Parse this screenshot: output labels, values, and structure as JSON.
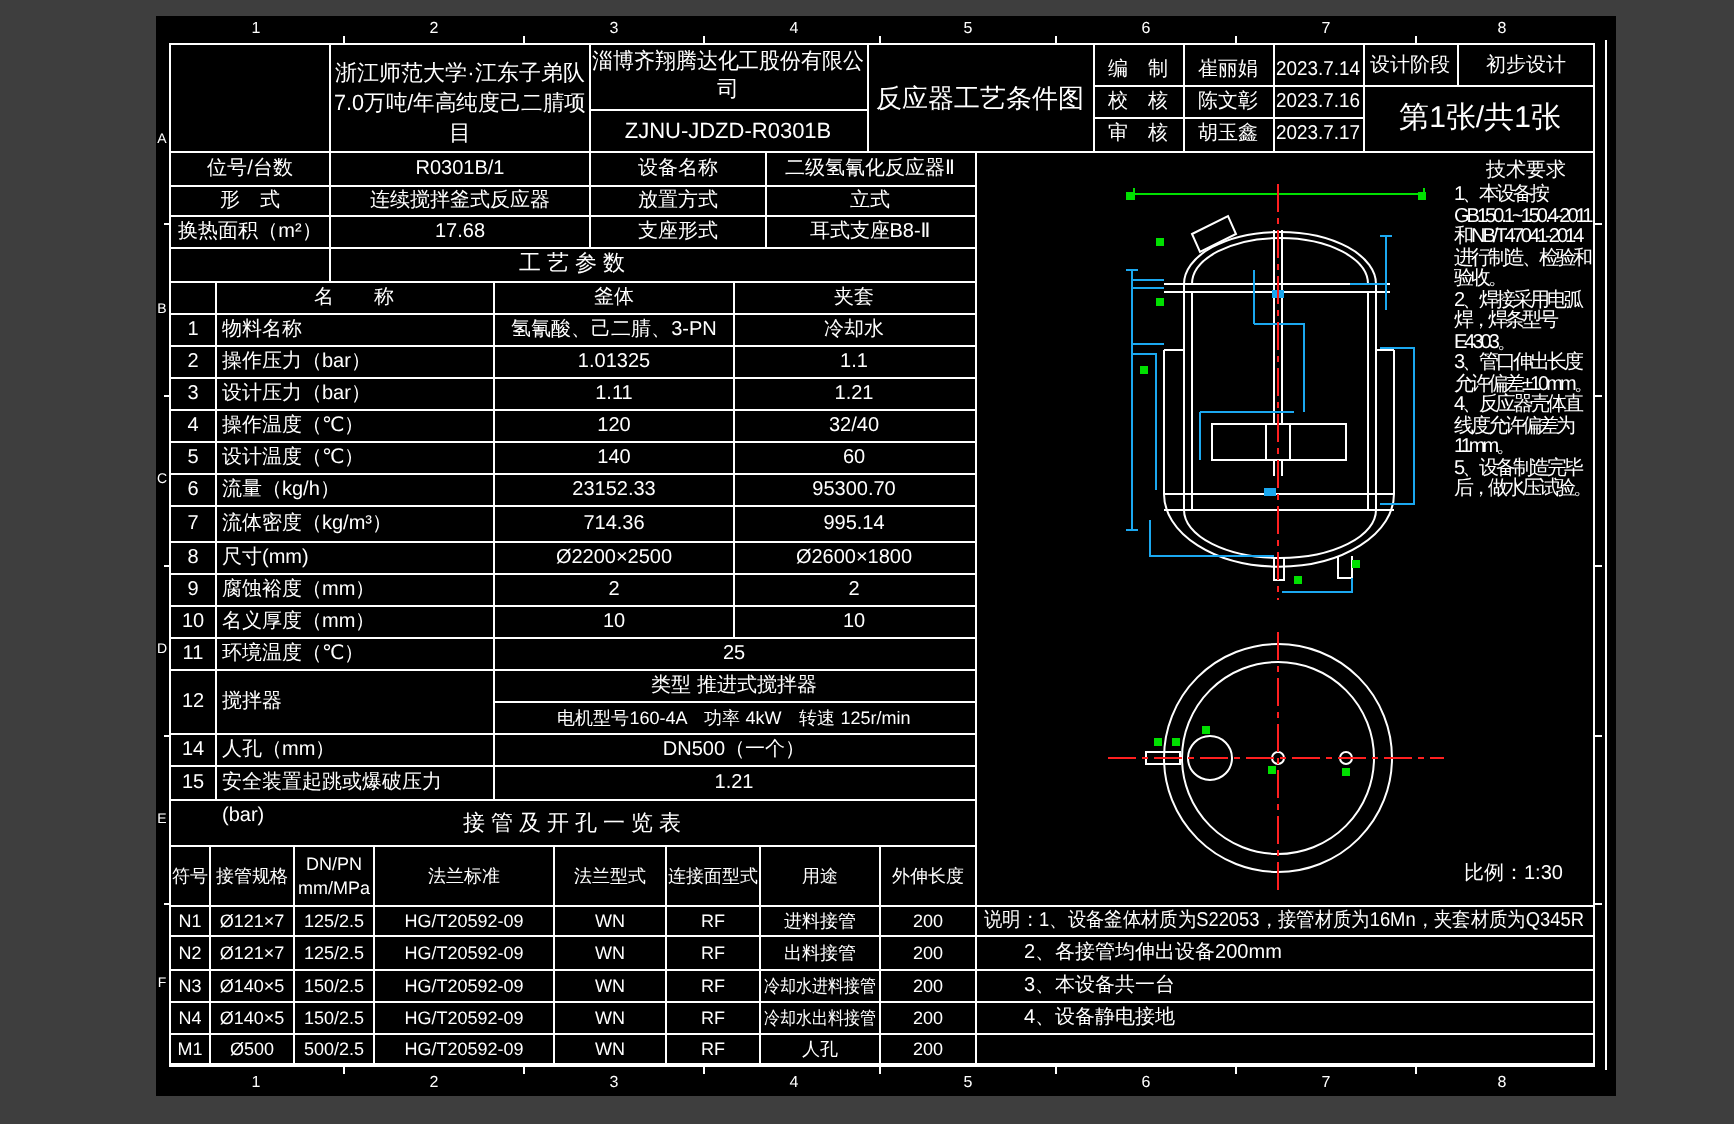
{
  "ruler": {
    "top_columns": [
      "1",
      "2",
      "3",
      "4",
      "5",
      "6",
      "7",
      "8"
    ],
    "bottom_columns": [
      "1",
      "2",
      "3",
      "4",
      "5",
      "6",
      "7",
      "8"
    ],
    "rows": [
      "A",
      "B",
      "C",
      "D",
      "E",
      "F"
    ]
  },
  "title_block": {
    "project_lines": [
      "浙江师范大学·江东子弟队",
      "7.0万吨/年高纯度己二腈项",
      "目"
    ],
    "company_lines": [
      "淄博齐翔腾达化工股份有限公",
      "司"
    ],
    "drawing_no": "ZJNU-JDZD-R0301B",
    "title": "反应器工艺条件图",
    "signatures": [
      {
        "role": "编　制",
        "name": "崔丽娟",
        "date": "2023.7.14"
      },
      {
        "role": "校　核",
        "name": "陈文彰",
        "date": "2023.7.16"
      },
      {
        "role": "审　核",
        "name": "胡玉鑫",
        "date": "2023.7.17"
      }
    ],
    "stage_label": "设计阶段",
    "stage": "初步设计",
    "sheet": "第1张/共1张"
  },
  "info_rows": [
    {
      "label": "位号/台数",
      "value": "R0301B/1",
      "label2": "设备名称",
      "value2": "二级氢氰化反应器Ⅱ"
    },
    {
      "label": "形　式",
      "value": "连续搅拌釜式反应器",
      "label2": "放置方式",
      "value2": "立式"
    },
    {
      "label": "换热面积（m²）",
      "value": "17.68",
      "label2": "支座形式",
      "value2": "耳式支座B8-Ⅱ"
    }
  ],
  "parameters": {
    "title": "工 艺 参 数",
    "columns": [
      "名　　称",
      "釜体",
      "夹套"
    ],
    "rows": [
      {
        "kind": "pair",
        "no": "1",
        "name": "物料名称",
        "body": "氢氰酸、己二腈、3-PN",
        "jacket": "冷却水"
      },
      {
        "kind": "pair",
        "no": "2",
        "name": "操作压力（bar）",
        "body": "1.01325",
        "jacket": "1.1"
      },
      {
        "kind": "pair",
        "no": "3",
        "name": "设计压力（bar）",
        "body": "1.11",
        "jacket": "1.21"
      },
      {
        "kind": "pair",
        "no": "4",
        "name": "操作温度（℃）",
        "body": "120",
        "jacket": "32/40"
      },
      {
        "kind": "pair",
        "no": "5",
        "name": "设计温度（℃）",
        "body": "140",
        "jacket": "60"
      },
      {
        "kind": "pair",
        "no": "6",
        "name": "流量（kg/h）",
        "body": "23152.33",
        "jacket": "95300.70"
      },
      {
        "kind": "pair",
        "no": "7",
        "name": "流体密度（kg/m³）",
        "body": "714.36",
        "jacket": "995.14"
      },
      {
        "kind": "pair",
        "no": "8",
        "name": "尺寸(mm)",
        "body": "Ø2200×2500",
        "jacket": "Ø2600×1800"
      },
      {
        "kind": "pair",
        "no": "9",
        "name": "腐蚀裕度（mm）",
        "body": "2",
        "jacket": "2"
      },
      {
        "kind": "pair",
        "no": "10",
        "name": "名义厚度（mm）",
        "body": "10",
        "jacket": "10"
      },
      {
        "kind": "merged",
        "no": "11",
        "name": "环境温度（℃）",
        "value": "25"
      },
      {
        "kind": "agitator",
        "no": "12",
        "name": "搅拌器",
        "lines": [
          "类型 推进式搅拌器",
          "电机型号160-4A　功率 4kW　转速 125r/min"
        ]
      },
      {
        "kind": "merged",
        "no": "14",
        "name": "人孔（mm）",
        "value": "DN500（一个）"
      },
      {
        "kind": "merged",
        "no": "15",
        "name": "安全装置起跳或爆破压力",
        "name_continued": "(bar)",
        "value": "1.21"
      }
    ]
  },
  "nozzles": {
    "title": "接 管 及 开 孔 一 览 表",
    "columns": [
      "符号",
      "接管规格",
      "DN/PN\nmm/MPa",
      "法兰标准",
      "法兰型式",
      "连接面型式",
      "用途",
      "外伸长度"
    ],
    "rows": [
      [
        "N1",
        "Ø121×7",
        "125/2.5",
        "HG/T20592-09",
        "WN",
        "RF",
        "进料接管",
        "200"
      ],
      [
        "N2",
        "Ø121×7",
        "125/2.5",
        "HG/T20592-09",
        "WN",
        "RF",
        "出料接管",
        "200"
      ],
      [
        "N3",
        "Ø140×5",
        "150/2.5",
        "HG/T20592-09",
        "WN",
        "RF",
        "冷却水进料接管",
        "200"
      ],
      [
        "N4",
        "Ø140×5",
        "150/2.5",
        "HG/T20592-09",
        "WN",
        "RF",
        "冷却水出料接管",
        "200"
      ],
      [
        "M1",
        "Ø500",
        "500/2.5",
        "HG/T20592-09",
        "WN",
        "RF",
        "人孔",
        "200"
      ]
    ]
  },
  "notes": {
    "lead": "说明：",
    "items": [
      "1、设备釜体材质为S22053，接管材质为16Mn，夹套材质为Q345R",
      "2、各接管均伸出设备200mm",
      "3、本设备共一台",
      "4、设备静电接地"
    ]
  },
  "requirements": {
    "title": "技术要求",
    "items": [
      "1、本设备按GB150.1~150.4-2011和NB/T47041-2014进行制造、检验和验收。",
      "2、焊接采用电弧焊，焊条型号E4303。",
      "3、管口伸出长度允许偏差±10mm。",
      "4、反应器壳体直线度允许偏差为11mm。",
      "5、设备制造完毕后，做水压试验。"
    ]
  },
  "scale": "比例：1:30"
}
